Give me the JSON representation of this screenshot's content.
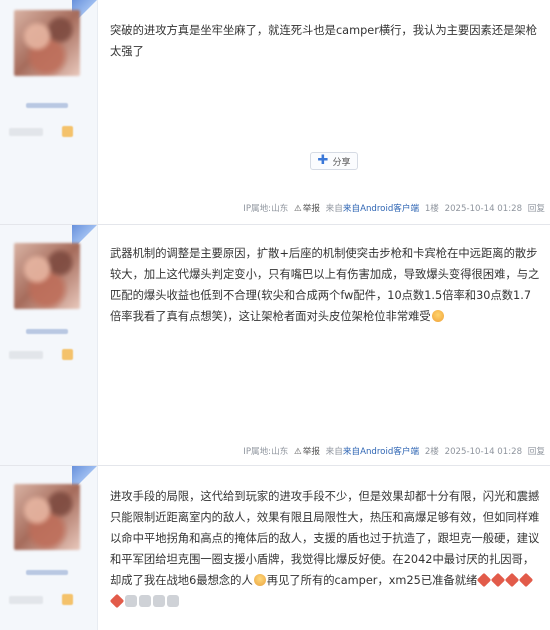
{
  "posts": [
    {
      "text": "突破的进攻方真是坐牢坐麻了，就连死斗也是camper横行，我认为主要因素还是架枪太强了",
      "share_label": "分享",
      "ip": "IP属地:山东",
      "report": "举报",
      "source": "来自Android客户端",
      "floor": "1楼",
      "time": "2025-10-14 01:28",
      "reply": "回复"
    },
    {
      "text": "武器机制的调整是主要原因，扩散+后座的机制使突击步枪和卡宾枪在中远距离的散步较大，加上这代爆头判定变小，只有嘴巴以上有伤害加成，导致爆头变得很困难，与之匹配的爆头收益也低到不合理(软尖和合成两个fw配件，10点数1.5倍率和30点数1.7倍率我看了真有点想笑)，这让架枪者面对头皮位架枪位非常难受",
      "ip": "IP属地:山东",
      "report": "举报",
      "source": "来自Android客户端",
      "floor": "2楼",
      "time": "2025-10-14 01:28",
      "reply": "回复"
    },
    {
      "text": "进攻手段的局限，这代给到玩家的进攻手段不少，但是效果却都十分有限，闪光和震撼只能限制近距离室内的敌人，效果有限且局限性大，热压和高爆足够有效，但如同样难以命中平地拐角和高点的掩体后的敌人，支援的盾也过于抗造了，跟坦克一般硬，建议和平军团给坦克围一圈支援小盾牌，我觉得比爆反好使。在2042中最讨厌的扎因哥，却成了我在战地6最想念的人",
      "text_after_emoji": "再见了所有的camper，xm25已准备就绪"
    }
  ]
}
